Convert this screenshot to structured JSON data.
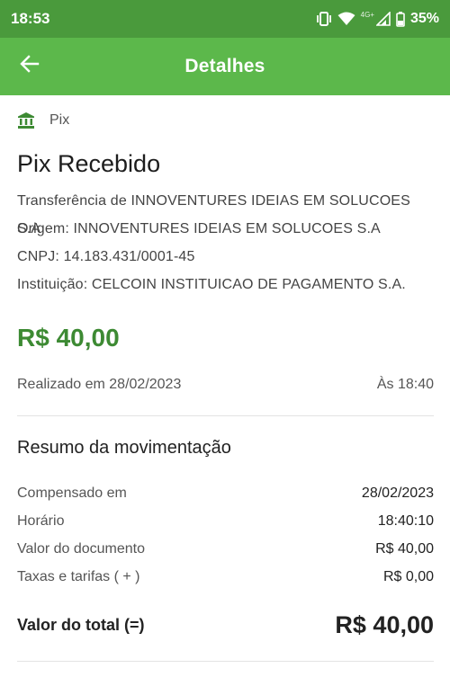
{
  "status_bar": {
    "time": "18:53",
    "network": "4G+",
    "battery": "35%"
  },
  "header": {
    "title": "Detalhes",
    "back_icon": "arrow-left-icon"
  },
  "category": {
    "icon": "bank-icon",
    "label": "Pix"
  },
  "transaction": {
    "title": "Pix Recebido",
    "description": "Transferência de INNOVENTURES IDEIAS EM SOLUCOES S.A",
    "origin": "Origem: INNOVENTURES IDEIAS EM SOLUCOES S.A",
    "cnpj": "CNPJ: 14.183.431/0001-45",
    "institution": "Instituição: CELCOIN INSTITUICAO DE PAGAMENTO S.A.",
    "amount": "R$ 40,00",
    "amount_color": "#3d8a33",
    "date_text": "Realizado em 28/02/2023",
    "time_text": "Às 18:40"
  },
  "summary": {
    "title": "Resumo da movimentação",
    "rows": [
      {
        "label": "Compensado em",
        "value": "28/02/2023"
      },
      {
        "label": "Horário",
        "value": "18:40:10"
      },
      {
        "label": "Valor do documento",
        "value": "R$ 40,00"
      },
      {
        "label": "Taxas e tarifas ( + )",
        "value": "R$ 0,00"
      }
    ],
    "total_label": "Valor do total (=)",
    "total_value": "R$ 40,00"
  },
  "colors": {
    "status_bar": "#4a9a3c",
    "app_bar": "#5cb84b",
    "accent_green": "#3d8a33"
  }
}
